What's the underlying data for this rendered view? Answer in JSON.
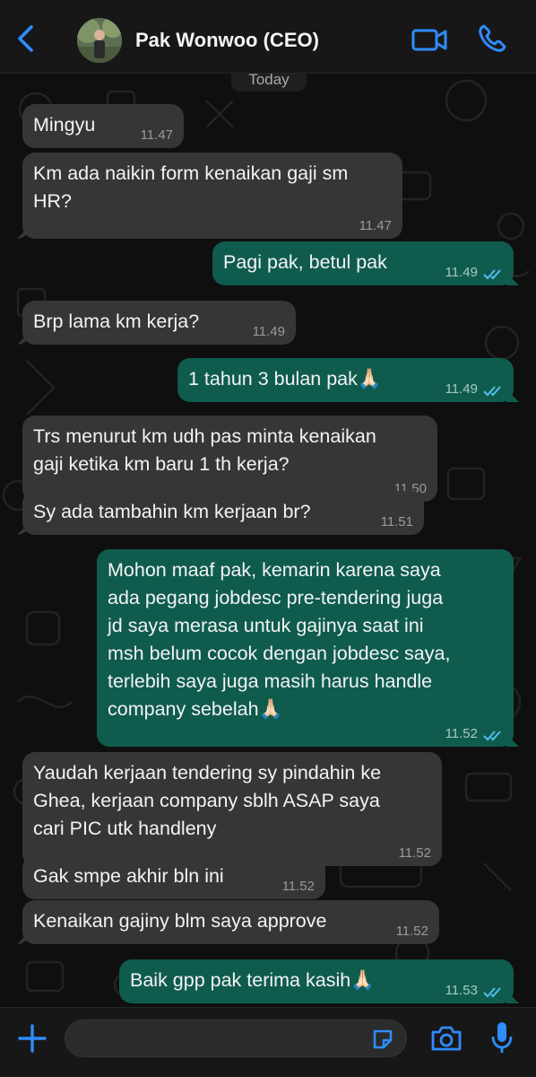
{
  "header": {
    "contact_name": "Pak Wonwoo (CEO)",
    "icons": [
      "chevron-left-icon",
      "avatar",
      "video-camera-icon",
      "phone-icon"
    ],
    "accent_color": "#2f8cff"
  },
  "chat": {
    "date_label": "Today",
    "messages": [
      {
        "dir": "in",
        "text": "Mingyu",
        "time": "11.47"
      },
      {
        "dir": "in",
        "text": "Km ada naikin form kenaikan gaji sm\nHR?",
        "time": "11.47"
      },
      {
        "dir": "out",
        "text": "Pagi pak, betul pak",
        "time": "11.49",
        "status": "read"
      },
      {
        "dir": "in",
        "text": "Brp lama km kerja?",
        "time": "11.49"
      },
      {
        "dir": "out",
        "text": "1 tahun 3 bulan pak🙏🏻",
        "time": "11.49",
        "status": "read"
      },
      {
        "dir": "in",
        "text": "Trs menurut km udh pas minta kenaikan\ngaji ketika km baru 1 th kerja?",
        "time": "11.50"
      },
      {
        "dir": "in",
        "text": "Sy ada tambahin km kerjaan br?",
        "time": "11.51"
      },
      {
        "dir": "out",
        "text": "Mohon maaf pak, kemarin karena saya\nada pegang jobdesc pre-tendering juga\njd saya merasa untuk gajinya saat ini\nmsh belum cocok dengan jobdesc saya,\nterlebih saya juga masih harus handle\ncompany sebelah🙏🏻",
        "time": "11.52",
        "status": "read"
      },
      {
        "dir": "in",
        "text": "Yaudah kerjaan tendering sy pindahin ke\nGhea, kerjaan company sblh ASAP saya\ncari PIC utk handleny",
        "time": "11.52"
      },
      {
        "dir": "in",
        "text": "Gak smpe akhir bln ini",
        "time": "11.52"
      },
      {
        "dir": "in",
        "text": "Kenaikan gajiny blm saya approve",
        "time": "11.52"
      },
      {
        "dir": "out",
        "text": "Baik gpp pak terima kasih🙏🏻",
        "time": "11.53",
        "status": "read"
      }
    ]
  },
  "composer": {
    "placeholder": "",
    "icons": [
      "plus-icon",
      "sticker-icon",
      "camera-icon",
      "microphone-icon"
    ]
  },
  "colors": {
    "incoming_bubble": "#363636",
    "outgoing_bubble": "#0f5c4e",
    "read_ticks": "#53bdeb"
  }
}
